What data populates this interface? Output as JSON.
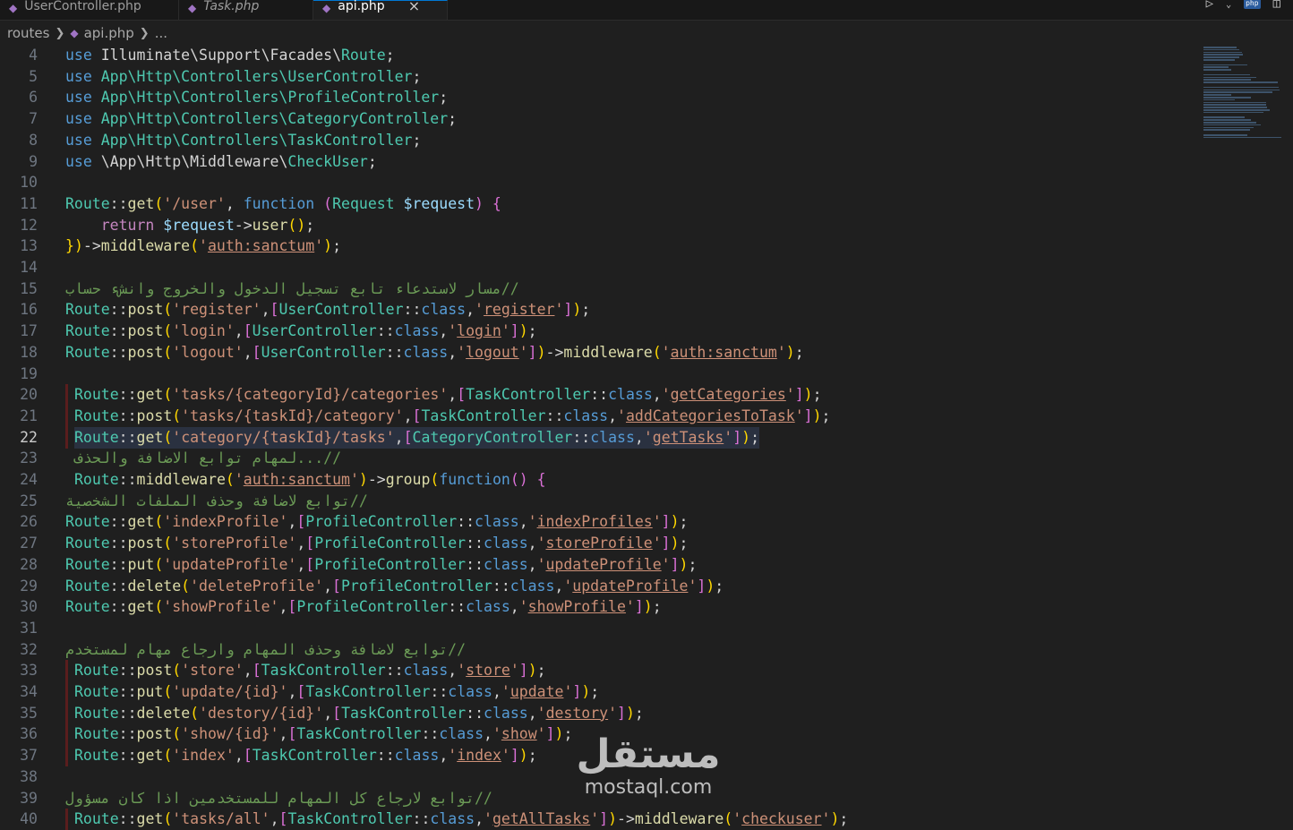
{
  "tabs": [
    {
      "label": "UserController.php",
      "italic": false,
      "active": false
    },
    {
      "label": "Task.php",
      "italic": true,
      "active": false
    },
    {
      "label": "api.php",
      "italic": false,
      "active": true
    }
  ],
  "tab_close_icon": "×",
  "breadcrumb": {
    "folder": "routes",
    "file": "api.php",
    "more": "..."
  },
  "lines": [
    {
      "n": "4",
      "text": "use Illuminate\\Support\\Facades\\Route;"
    },
    {
      "n": "5",
      "text": "use App\\Http\\Controllers\\UserController;"
    },
    {
      "n": "6",
      "text": "use App\\Http\\Controllers\\ProfileController;"
    },
    {
      "n": "7",
      "text": "use App\\Http\\Controllers\\CategoryController;"
    },
    {
      "n": "8",
      "text": "use App\\Http\\Controllers\\TaskController;"
    },
    {
      "n": "9",
      "text": "use \\App\\Http\\Middleware\\CheckUser;"
    },
    {
      "n": "10",
      "text": ""
    },
    {
      "n": "11",
      "text": "Route::get('/user', function (Request $request) {"
    },
    {
      "n": "12",
      "text": "    return $request->user();"
    },
    {
      "n": "13",
      "text": "})->middleware('auth:sanctum');"
    },
    {
      "n": "14",
      "text": ""
    },
    {
      "n": "15",
      "text": "//مسار لاستدعاء تابع تسجيل الدخول والخروج وانشء حساب"
    },
    {
      "n": "16",
      "text": "Route::post('register',[UserController::class,'register']);"
    },
    {
      "n": "17",
      "text": "Route::post('login',[UserController::class,'login']);"
    },
    {
      "n": "18",
      "text": "Route::post('logout',[UserController::class,'logout'])->middleware('auth:sanctum');"
    },
    {
      "n": "19",
      "text": ""
    },
    {
      "n": "20",
      "text": "Route::get('tasks/{categoryId}/categories',[TaskController::class,'getCategories']);"
    },
    {
      "n": "21",
      "text": "Route::post('tasks/{taskId}/category',[TaskController::class,'addCategoriesToTask']);"
    },
    {
      "n": "22",
      "text": "Route::get('category/{taskId}/tasks',[CategoryController::class,'getTasks']);"
    },
    {
      "n": "23",
      "text": "//...لمهام توابع الاضافة والحذف"
    },
    {
      "n": "24",
      "text": "Route::middleware('auth:sanctum')->group(function() {"
    },
    {
      "n": "25",
      "text": "//توابع لاضافة وحذف الملفات الشخصية"
    },
    {
      "n": "26",
      "text": "Route::get('indexProfile',[ProfileController::class,'indexProfiles']);"
    },
    {
      "n": "27",
      "text": "Route::post('storeProfile',[ProfileController::class,'storeProfile']);"
    },
    {
      "n": "28",
      "text": "Route::put('updateProfile',[ProfileController::class,'updateProfile']);"
    },
    {
      "n": "29",
      "text": "Route::delete('deleteProfile',[ProfileController::class,'updateProfile']);"
    },
    {
      "n": "30",
      "text": "Route::get('showProfile',[ProfileController::class,'showProfile']);"
    },
    {
      "n": "31",
      "text": ""
    },
    {
      "n": "32",
      "text": "//توابع لاضافة وحذف المهام وارجاع مهام لمستخدم"
    },
    {
      "n": "33",
      "text": "Route::post('store',[TaskController::class,'store']);"
    },
    {
      "n": "34",
      "text": "Route::put('update/{id}',[TaskController::class,'update']);"
    },
    {
      "n": "35",
      "text": "Route::delete('destory/{id}',[TaskController::class,'destory']);"
    },
    {
      "n": "36",
      "text": "Route::post('show/{id}',[TaskController::class,'show']);"
    },
    {
      "n": "37",
      "text": "Route::get('index',[TaskController::class,'index']);"
    },
    {
      "n": "38",
      "text": ""
    },
    {
      "n": "39",
      "text": "//توابع لارجاع كل المهام للمستخدمين اذا كان مسؤول"
    },
    {
      "n": "40",
      "text": "Route::get('tasks/all',[TaskController::class,'getAllTasks'])->middleware('checkuser');"
    }
  ],
  "current_line": "22",
  "watermark": {
    "arabic": "مستقل",
    "latin": "mostaql.com"
  },
  "colors": {
    "background": "#1f1f1f",
    "keyword": "#569cd6",
    "class": "#4ec9b0",
    "function": "#dcdcaa",
    "string": "#ce9178",
    "variable": "#9cdcfe",
    "comment": "#6a9955",
    "php_icon": "#a074c4"
  },
  "icons": [
    "php-file-icon",
    "close-icon",
    "chevron-right-icon",
    "run-icon",
    "split-editor-icon"
  ]
}
